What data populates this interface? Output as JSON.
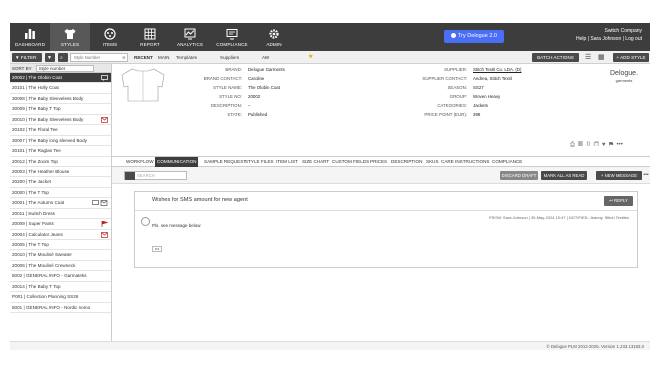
{
  "nav": {
    "items": [
      {
        "label": "DASHBOARD",
        "icon": "dashboard-icon"
      },
      {
        "label": "STYLES",
        "icon": "shirt-icon"
      },
      {
        "label": "ITEMS",
        "icon": "items-icon"
      },
      {
        "label": "REPORT",
        "icon": "report-icon"
      },
      {
        "label": "ANALYTICS",
        "icon": "analytics-icon"
      },
      {
        "label": "COMPLIANCE",
        "icon": "compliance-icon"
      },
      {
        "label": "ADMIN",
        "icon": "gear-icon"
      }
    ],
    "try_button": "Try Delogue 2.0",
    "company": "Switch Company",
    "user_line": "Help | Sara Johnson | Log out"
  },
  "toolbar": {
    "filter_label": "FILTER",
    "search_placeholder": "Style Number",
    "tabs": [
      "RECENT",
      "MAIN",
      "Templates",
      "Suppliers",
      "AW"
    ],
    "batch_label": "BATCH ACTIONS",
    "add_style_label": "ADD STYLE"
  },
  "sidebar": {
    "sort_label": "SORT BY",
    "sort_value": "Style number",
    "items": [
      {
        "label": "20002 | The Olobin Coat",
        "active": true,
        "icon": "comment-icon"
      },
      {
        "label": "20101 | The Holly Coat"
      },
      {
        "label": "30008 | The Baby Sleeveless Body"
      },
      {
        "label": "30009 | The Baby T Top"
      },
      {
        "label": "30010 | The Baby Sleeveless Body",
        "icon": "mail-icon"
      },
      {
        "label": "20102 | The Floral Tee"
      },
      {
        "label": "30007 | The Baby long sleeved Body"
      },
      {
        "label": "30101 | The Raglan Tee"
      },
      {
        "label": "20012 | The Zoom Top"
      },
      {
        "label": "20003 | The Heather Blouse"
      },
      {
        "label": "20200 | The Jacket"
      },
      {
        "label": "20000 | The T Top"
      },
      {
        "label": "20001 | The Autumn Coat",
        "icon": "comment-mail-icon"
      },
      {
        "label": "20011 | Switch Dress"
      },
      {
        "label": "20009 | Super Pants",
        "icon": "flag-icon"
      },
      {
        "label": "20004 | Calculator Jeans",
        "icon": "mail-icon"
      },
      {
        "label": "20005 | The T Top"
      },
      {
        "label": "20010 | The Mouliné Sweater"
      },
      {
        "label": "20006 | The Mouliné Crewneck"
      },
      {
        "label": "5002 | GENERAL INFO - Garmateks"
      },
      {
        "label": "30014 | The Baby T Top"
      },
      {
        "label": "P001 | Collection Planning SS26"
      },
      {
        "label": "5001 | GENERAL INFO - Nordic nomo"
      }
    ]
  },
  "details": {
    "left": [
      {
        "label": "BRAND:",
        "value": "Delogue Garments"
      },
      {
        "label": "BRAND CONTACT:",
        "value": "Caroline"
      },
      {
        "label": "STYLE NAME:",
        "value": "The Olobin Coat"
      },
      {
        "label": "STYLE NO:",
        "value": "20002"
      },
      {
        "label": "DESCRIPTION:",
        "value": "–"
      },
      {
        "label": "STATE:",
        "value": "Published"
      }
    ],
    "right": [
      {
        "label": "SUPPLIER:",
        "value": "Stitch Textil Co. LDA. (D)"
      },
      {
        "label": "SUPPLIER CONTACT:",
        "value": "Andrea, Stitch Textil"
      },
      {
        "label": "SEASON:",
        "value": "SS27"
      },
      {
        "label": "GROUP:",
        "value": "Woven Heavy"
      },
      {
        "label": "CATEGORIES:",
        "value": "Jackets"
      },
      {
        "label": "PRICE POINT (EUR):",
        "value": "399"
      }
    ],
    "brand_logo": "Delogue.",
    "brand_logo_sub": "garments"
  },
  "tabs": [
    "WORKFLOW",
    "COMMUNICATION",
    "SAMPLE REQUEST",
    "STYLE FILES",
    "ITEM LIST",
    "SIZE CHART",
    "CUSTOM FIELDS",
    "PRICES",
    "DESCRIPTION",
    "SKUS",
    "CARE INSTRUCTIONS",
    "COMPLIANCE"
  ],
  "comm": {
    "search_placeholder": "SEARCH",
    "discard_label": "DISCARD DRAFT",
    "mark_label": "MARK ALL AS READ",
    "new_label": "NEW MESSAGE",
    "message": {
      "title": "Wishes for SMS amount for new agent",
      "reply": "REPLY",
      "from": "FROM: Sara Johnson | 30-May-2024 10:47 | NOTIFIED: Jeanny, Stitch Textiles",
      "body": "Pls. see message below",
      "more": "•••"
    }
  },
  "footer": "© Delogue PLM 2012-2025. Version 1.233.13183.0"
}
